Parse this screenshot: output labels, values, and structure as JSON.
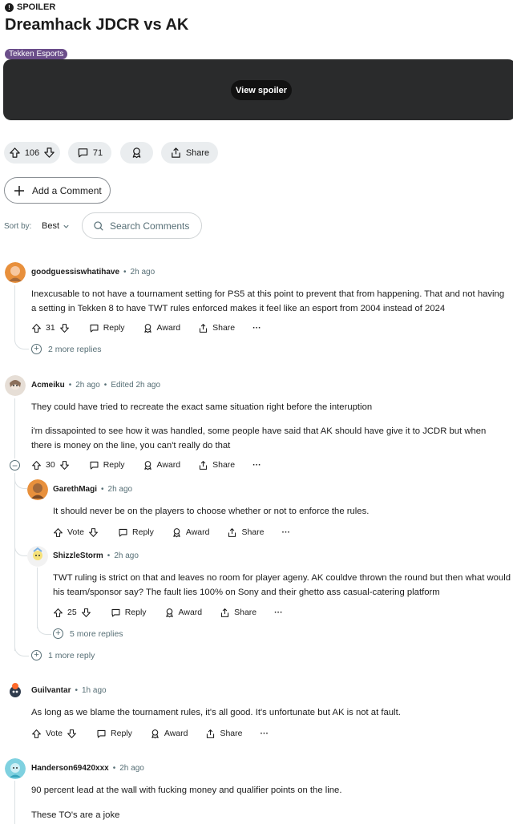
{
  "post": {
    "spoiler_label": "SPOILER",
    "title": "Dreamhack JDCR vs AK",
    "flair": "Tekken Esports",
    "view_spoiler": "View spoiler",
    "votes": "106",
    "comments_count": "71",
    "share_label": "Share"
  },
  "add_comment_label": "Add a Comment",
  "sort": {
    "label": "Sort by:",
    "value": "Best"
  },
  "search": {
    "placeholder": "Search Comments"
  },
  "comments": [
    {
      "author": "goodguessiswhatihave",
      "time": "2h ago",
      "body": "Inexcusable to not have a tournament setting for PS5 at this point to prevent that from happening. That and not having a setting in Tekken 8 to have TWT rules enforced makes it feel like an esport from 2004 instead of 2024",
      "votes": "31",
      "more_replies": "2 more replies"
    },
    {
      "author": "Acmeiku",
      "time": "2h ago",
      "edited": "Edited 2h ago",
      "body_p1": "They could have tried to recreate the exact same situation right before the interuption",
      "body_p2": "i'm dissapointed to see how it was handled, some people have said that AK should have give it to JCDR but when there is money on the line, you can't really do that",
      "votes": "30",
      "more_replies": "1 more reply",
      "replies": [
        {
          "author": "GarethMagi",
          "time": "2h ago",
          "body": "It should never be on the players to choose whether or not to enforce the rules.",
          "votes": "Vote"
        },
        {
          "author": "ShizzleStorm",
          "time": "2h ago",
          "body": "TWT ruling is strict on that and leaves no room for player ageny. AK couldve thrown the round but then what would his team/sponsor say? The fault lies 100% on Sony and their ghetto ass casual-catering platform",
          "votes": "25",
          "more_replies": "5 more replies"
        }
      ]
    },
    {
      "author": "Guilvantar",
      "time": "1h ago",
      "body": "As long as we blame the tournament rules, it's all good. It's unfortunate but AK is not at fault.",
      "votes": "Vote"
    },
    {
      "author": "Handerson69420xxx",
      "time": "2h ago",
      "body_p1": "90 percent lead at the wall with fucking money and qualifier points on the line.",
      "body_p2": "These TO's are a joke"
    }
  ],
  "action_labels": {
    "reply": "Reply",
    "award": "Award",
    "share": "Share",
    "more": "···"
  },
  "colors": {
    "flair": "#6b4e8a",
    "pill_bg": "#eaedef",
    "meta": "#576f76",
    "thread_line": "#dbe0e3"
  }
}
